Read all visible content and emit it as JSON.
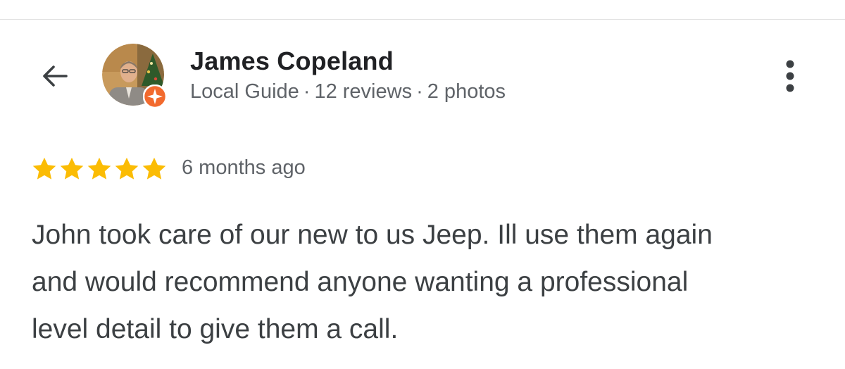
{
  "reviewer": {
    "name": "James Copeland",
    "badge": "Local Guide",
    "separator": "·",
    "reviews": "12 reviews",
    "photos": "2 photos"
  },
  "review": {
    "rating": 5,
    "max_rating": 5,
    "time": "6 months ago",
    "text": "John took care of our new to us Jeep. Ill use them again and would recommend anyone wanting a professional level detail to give them a call."
  },
  "icons": {
    "back": "arrow-left-icon",
    "more": "more-vertical-icon",
    "star": "star-icon",
    "badge": "local-guide-badge-icon"
  },
  "colors": {
    "star": "#fbbc04",
    "badge": "#f26a2e",
    "secondary_text": "#5f6368",
    "primary_text": "#202124",
    "body_text": "#3c4043"
  }
}
